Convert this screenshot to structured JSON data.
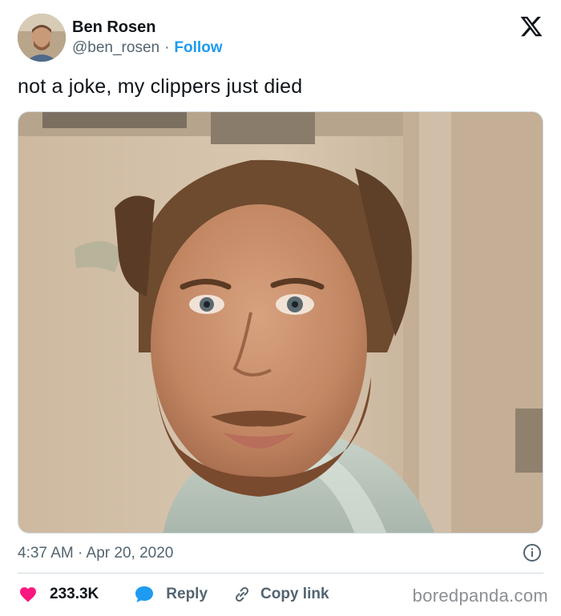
{
  "author": {
    "display_name": "Ben Rosen",
    "handle": "@ben_rosen",
    "separator": "·",
    "follow_label": "Follow"
  },
  "platform_icon": "x-logo-icon",
  "tweet": {
    "text": "not a joke, my clippers just died",
    "timestamp": "4:37 AM · Apr 20, 2020"
  },
  "actions": {
    "like": {
      "icon": "heart-icon",
      "count": "233.3K",
      "color": "#f91880"
    },
    "reply": {
      "icon": "speech-bubble-icon",
      "label": "Reply",
      "color": "#1d9bf0"
    },
    "copy_link": {
      "icon": "link-icon",
      "label": "Copy link"
    }
  },
  "info_icon": "info-circle-icon",
  "watermark": "boredpanda.com",
  "colors": {
    "accent": "#1d9bf0",
    "text_primary": "#0f1419",
    "text_secondary": "#536471",
    "border": "#cfd9de"
  }
}
